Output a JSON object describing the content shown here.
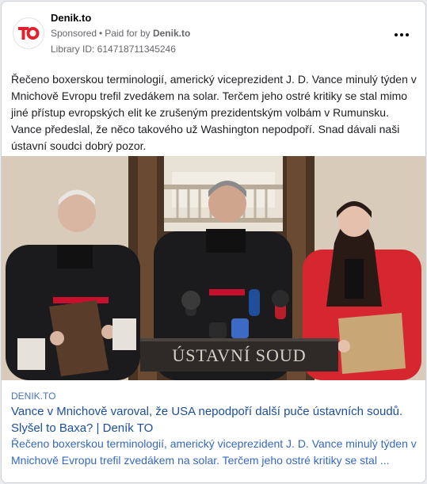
{
  "post": {
    "page_name": "Denik.to",
    "sponsored_label": "Sponsored",
    "separator": "•",
    "paid_for_by_label": "Paid for by",
    "paid_for_by_name": "Denik.to",
    "library_id": "Library ID: 614718711345246",
    "body": "Řečeno boxerskou terminologií, americký viceprezident J. D. Vance minulý týden v Mnichově Evropu trefil zvedákem na solar. Terčem jeho ostré kritiky se stal mimo jiné přístup evropských elit ke zrušeným prezidentským volbám v Rumunsku. Vance předeslal, že něco takového už Washington nepodpoří. Snad dávali naši ústavní soudci dobrý pozor."
  },
  "logo": {
    "text": "TO",
    "color": "#e3202b"
  },
  "photo": {
    "podium_text": "ÚSTAVNÍ SOUD"
  },
  "link": {
    "domain": "DENIK.TO",
    "title": "Vance v Mnichově varoval, že USA nepodpoří další puče ústavních soudů. Slyšel to Baxa? | Deník TO",
    "description": "Řečeno boxerskou terminologií, americký viceprezident J. D. Vance minulý týden v Mnichově Evropu trefil zvedákem na solar. Terčem jeho ostré kritiky se stal ..."
  },
  "icons": {
    "more": "more-horizontal-icon",
    "avatar": "denik-to-logo"
  }
}
